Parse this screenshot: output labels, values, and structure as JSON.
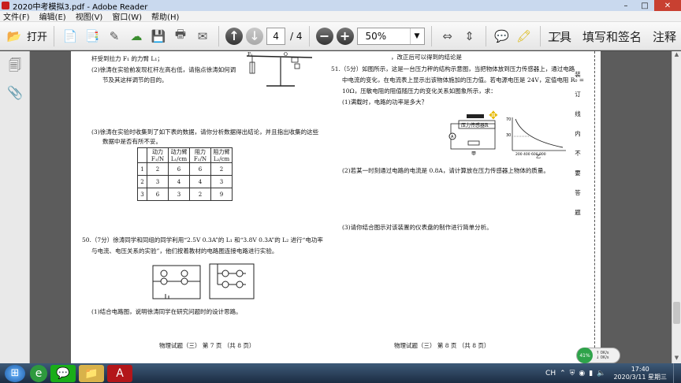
{
  "window": {
    "title": "2020中考模拟3.pdf - Adobe Reader",
    "controls": [
      "–",
      "□",
      "✕"
    ]
  },
  "menu": [
    "文件(F)",
    "编辑(E)",
    "视图(V)",
    "窗口(W)",
    "帮助(H)"
  ],
  "toolbar": {
    "open_label": "打开",
    "page_current": "4",
    "page_total": "/ 4",
    "zoom": "50%",
    "tools_label": "工具",
    "fill_sign_label": "填写和签名",
    "comment_label": "注释"
  },
  "document": {
    "left": {
      "q_top_1": "杆受到拉力 F₁ 的力臂 L₁；",
      "q_top_2": "(2)徐涛在实验前发现杠杆左高右低，请指点徐涛如何调",
      "q_top_3": "节及其这样调节的目的。",
      "q3_1": "(3)徐涛在实验时收集到了如下表的数据，请你分析数据得出结论，并且指出收集的这些",
      "q3_2": "数据中是否有所不妥。",
      "table_headers": [
        "",
        "动力 F₁/N",
        "动力臂 L₁/cm",
        "阻力 F₂/N",
        "阻力臂 L₂/cm"
      ],
      "table_rows": [
        [
          "1",
          "2",
          "6",
          "6",
          "2"
        ],
        [
          "2",
          "3",
          "4",
          "4",
          "3"
        ],
        [
          "3",
          "6",
          "3",
          "2",
          "9"
        ]
      ],
      "q50_1": "50.（7分）徐涛同学和同组的同学利用“2.5V 0.3A”的 L₁ 和“3.8V 0.3A”的 L₂ 进行“电功率",
      "q50_2": "与电流、电压关系的实验”，他们按着教材的电路图连接电路进行实验。",
      "q50_3": "(1)结合电路图，说明徐涛同学在研究问题时的设计思路。",
      "footer": "物理试题（三）  第 7 页  （共 8 页）"
    },
    "right": {
      "top": "，改正后可以得到的结论是",
      "q51_1": "51.（5分）如图所示，这是一台压力秤的结构示意图，当把物体放到压力传感器上，通过电路",
      "q51_2": "中电流的变化，在电流表上显示出该物体施加的压力值。若电源电压是 24V，定值电阻 R₀ =",
      "q51_3": "10Ω，压敏电阻的阻值随压力的变化关系如图象所示，求：",
      "q51_a": "(1)满载时，电路的功率是多大？",
      "q51_b": "(2)若某一时刻通过电路的电流是 0.8A，请计算放在压力传感器上物体的质量。",
      "q51_c": "(3)请你结合图示对该装置的仪表盘的制作进行简单分析。",
      "sensor_label": "压力传感器R",
      "jia": "甲",
      "yi": "乙",
      "footer": "物理试题（三）  第 8 页  （共 8 页）"
    },
    "margin_vertical": [
      "装",
      "订",
      "线",
      "内",
      "不",
      "要",
      "答",
      "题"
    ]
  },
  "taskbar": {
    "time": "17:40",
    "date": "2020/3/11 星期三",
    "lang": "CH",
    "widget_pct": "41%",
    "widget_up": "0K/s",
    "widget_down": "0K/s"
  }
}
